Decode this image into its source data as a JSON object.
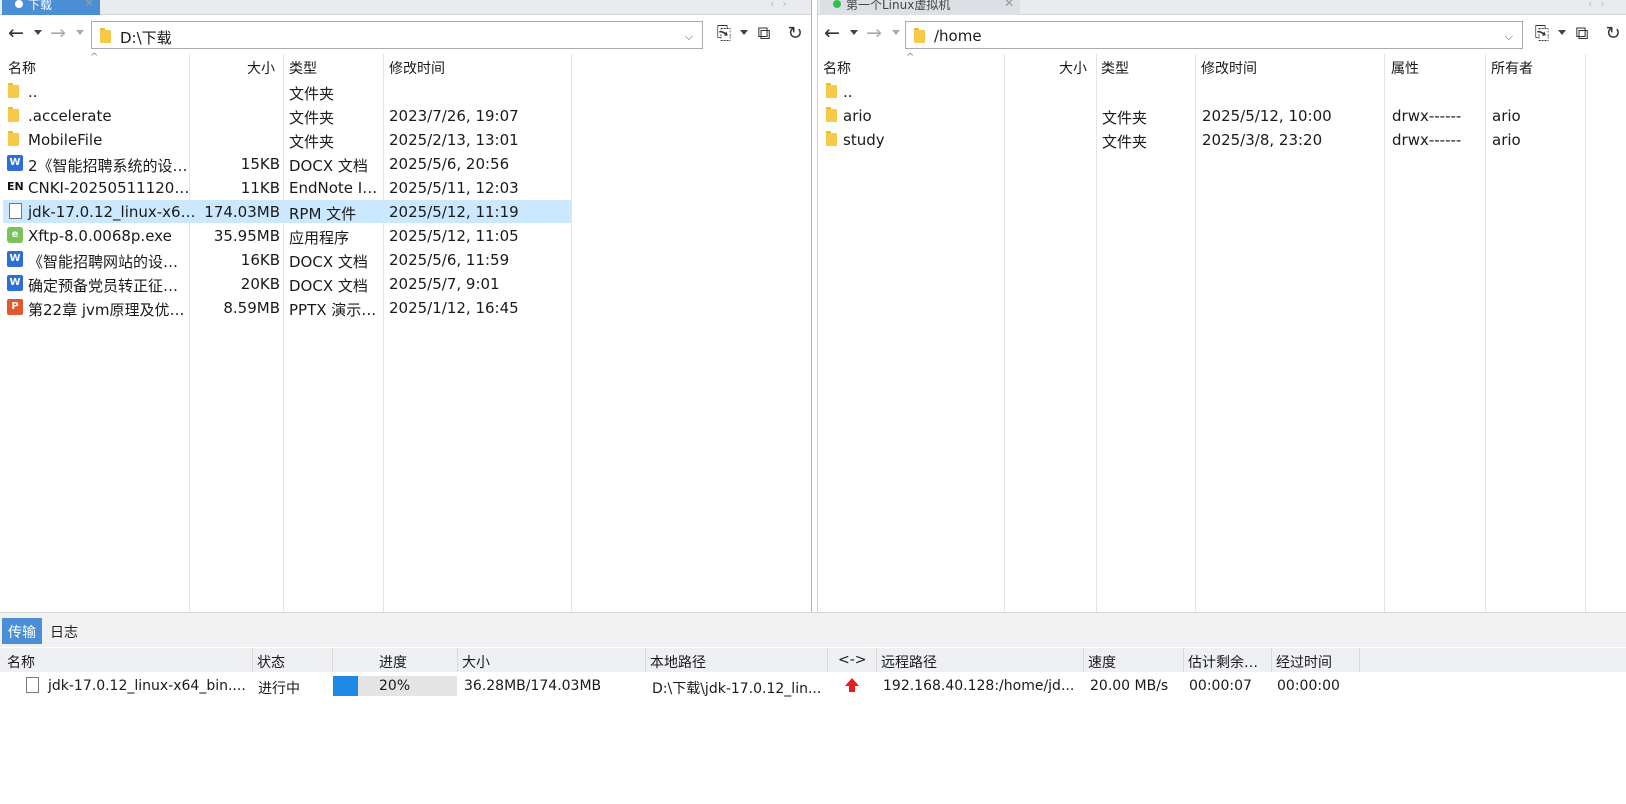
{
  "left": {
    "tab_label": "下载",
    "path": "D:\\下载",
    "columns": {
      "name": "名称",
      "size": "大小",
      "type": "类型",
      "modified": "修改时间"
    },
    "rows": [
      {
        "icon": "folder-icon",
        "name": "..",
        "size": "",
        "type": "文件夹",
        "modified": ""
      },
      {
        "icon": "folder-icon",
        "name": ".accelerate",
        "size": "",
        "type": "文件夹",
        "modified": "2023/7/26, 19:07"
      },
      {
        "icon": "folder-icon",
        "name": "MobileFile",
        "size": "",
        "type": "文件夹",
        "modified": "2025/2/13, 13:01"
      },
      {
        "icon": "word-doc-icon",
        "name": "2《智能招聘系统的设…",
        "size": "15KB",
        "type": "DOCX 文档",
        "modified": "2025/5/6, 20:56"
      },
      {
        "icon": "endnote-icon",
        "name": "CNKI-20250511120…",
        "size": "11KB",
        "type": "EndNote I…",
        "modified": "2025/5/11, 12:03"
      },
      {
        "icon": "file-icon",
        "name": "jdk-17.0.12_linux-x6…",
        "size": "174.03MB",
        "type": "RPM 文件",
        "modified": "2025/5/12, 11:19",
        "selected": true
      },
      {
        "icon": "exe-icon",
        "name": "Xftp-8.0.0068p.exe",
        "size": "35.95MB",
        "type": "应用程序",
        "modified": "2025/5/12, 11:05"
      },
      {
        "icon": "word-doc-icon",
        "name": "《智能招聘网站的设…",
        "size": "16KB",
        "type": "DOCX 文档",
        "modified": "2025/5/6, 11:59"
      },
      {
        "icon": "word-doc-icon",
        "name": "确定预备党员转正征…",
        "size": "20KB",
        "type": "DOCX 文档",
        "modified": "2025/5/7, 9:01"
      },
      {
        "icon": "ppt-icon",
        "name": "第22章 jvm原理及优…",
        "size": "8.59MB",
        "type": "PPTX 演示…",
        "modified": "2025/1/12, 16:45"
      }
    ]
  },
  "right": {
    "tab_label": "第一个Linux虚拟机",
    "path": "/home",
    "columns": {
      "name": "名称",
      "size": "大小",
      "type": "类型",
      "modified": "修改时间",
      "attr": "属性",
      "owner": "所有者"
    },
    "rows": [
      {
        "icon": "folder-icon",
        "name": "..",
        "size": "",
        "type": "",
        "modified": "",
        "attr": "",
        "owner": ""
      },
      {
        "icon": "folder-icon",
        "name": "ario",
        "size": "",
        "type": "文件夹",
        "modified": "2025/5/12, 10:00",
        "attr": "drwx------",
        "owner": "ario"
      },
      {
        "icon": "folder-icon",
        "name": "study",
        "size": "",
        "type": "文件夹",
        "modified": "2025/3/8, 23:20",
        "attr": "drwx------",
        "owner": "ario"
      }
    ]
  },
  "bottom": {
    "tabs": {
      "transfer": "传输",
      "log": "日志"
    },
    "columns": {
      "name": "名称",
      "status": "状态",
      "progress": "进度",
      "size": "大小",
      "local": "本地路径",
      "direction": "<->",
      "remote": "远程路径",
      "speed": "速度",
      "eta": "估计剩余…",
      "elapsed": "经过时间"
    },
    "transfer": {
      "name": "jdk-17.0.12_linux-x64_bin....",
      "status": "进行中",
      "progress_label": "20%",
      "progress_fraction": 0.2,
      "size": "36.28MB/174.03MB",
      "local": "D:\\下载\\jdk-17.0.12_lin...",
      "direction_icon": "upload-arrow-icon",
      "remote": "192.168.40.128:/home/jd...",
      "speed": "20.00 MB/s",
      "eta": "00:00:07",
      "elapsed": "00:00:00"
    }
  },
  "colors": {
    "accent": "#4a8fd6",
    "selection": "#cce8ff",
    "progress": "#1e88e5",
    "upload_arrow": "#e81e1e"
  }
}
